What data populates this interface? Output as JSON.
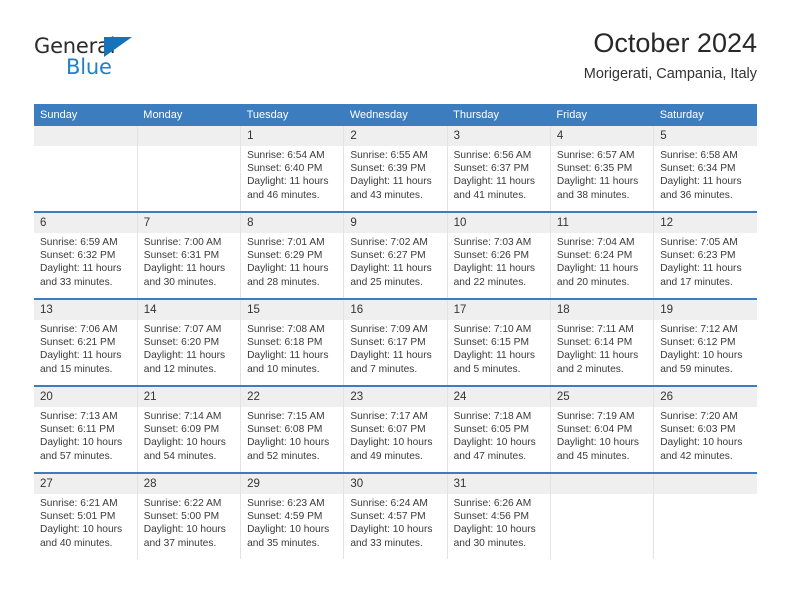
{
  "brand": {
    "name_part1": "General",
    "name_part2": "Blue",
    "accent_color": "#1f81c9",
    "triangle_color": "#1672b9"
  },
  "header": {
    "title": "October 2024",
    "subtitle": "Morigerati, Campania, Italy"
  },
  "calendar": {
    "header_bg": "#3b7dbf",
    "daynum_bg": "#efefef",
    "weekdays": [
      "Sunday",
      "Monday",
      "Tuesday",
      "Wednesday",
      "Thursday",
      "Friday",
      "Saturday"
    ],
    "weeks": [
      [
        {
          "day": "",
          "sunrise": "",
          "sunset": "",
          "daylight_line1": "",
          "daylight_line2": ""
        },
        {
          "day": "",
          "sunrise": "",
          "sunset": "",
          "daylight_line1": "",
          "daylight_line2": ""
        },
        {
          "day": "1",
          "sunrise": "Sunrise: 6:54 AM",
          "sunset": "Sunset: 6:40 PM",
          "daylight_line1": "Daylight: 11 hours",
          "daylight_line2": "and 46 minutes."
        },
        {
          "day": "2",
          "sunrise": "Sunrise: 6:55 AM",
          "sunset": "Sunset: 6:39 PM",
          "daylight_line1": "Daylight: 11 hours",
          "daylight_line2": "and 43 minutes."
        },
        {
          "day": "3",
          "sunrise": "Sunrise: 6:56 AM",
          "sunset": "Sunset: 6:37 PM",
          "daylight_line1": "Daylight: 11 hours",
          "daylight_line2": "and 41 minutes."
        },
        {
          "day": "4",
          "sunrise": "Sunrise: 6:57 AM",
          "sunset": "Sunset: 6:35 PM",
          "daylight_line1": "Daylight: 11 hours",
          "daylight_line2": "and 38 minutes."
        },
        {
          "day": "5",
          "sunrise": "Sunrise: 6:58 AM",
          "sunset": "Sunset: 6:34 PM",
          "daylight_line1": "Daylight: 11 hours",
          "daylight_line2": "and 36 minutes."
        }
      ],
      [
        {
          "day": "6",
          "sunrise": "Sunrise: 6:59 AM",
          "sunset": "Sunset: 6:32 PM",
          "daylight_line1": "Daylight: 11 hours",
          "daylight_line2": "and 33 minutes."
        },
        {
          "day": "7",
          "sunrise": "Sunrise: 7:00 AM",
          "sunset": "Sunset: 6:31 PM",
          "daylight_line1": "Daylight: 11 hours",
          "daylight_line2": "and 30 minutes."
        },
        {
          "day": "8",
          "sunrise": "Sunrise: 7:01 AM",
          "sunset": "Sunset: 6:29 PM",
          "daylight_line1": "Daylight: 11 hours",
          "daylight_line2": "and 28 minutes."
        },
        {
          "day": "9",
          "sunrise": "Sunrise: 7:02 AM",
          "sunset": "Sunset: 6:27 PM",
          "daylight_line1": "Daylight: 11 hours",
          "daylight_line2": "and 25 minutes."
        },
        {
          "day": "10",
          "sunrise": "Sunrise: 7:03 AM",
          "sunset": "Sunset: 6:26 PM",
          "daylight_line1": "Daylight: 11 hours",
          "daylight_line2": "and 22 minutes."
        },
        {
          "day": "11",
          "sunrise": "Sunrise: 7:04 AM",
          "sunset": "Sunset: 6:24 PM",
          "daylight_line1": "Daylight: 11 hours",
          "daylight_line2": "and 20 minutes."
        },
        {
          "day": "12",
          "sunrise": "Sunrise: 7:05 AM",
          "sunset": "Sunset: 6:23 PM",
          "daylight_line1": "Daylight: 11 hours",
          "daylight_line2": "and 17 minutes."
        }
      ],
      [
        {
          "day": "13",
          "sunrise": "Sunrise: 7:06 AM",
          "sunset": "Sunset: 6:21 PM",
          "daylight_line1": "Daylight: 11 hours",
          "daylight_line2": "and 15 minutes."
        },
        {
          "day": "14",
          "sunrise": "Sunrise: 7:07 AM",
          "sunset": "Sunset: 6:20 PM",
          "daylight_line1": "Daylight: 11 hours",
          "daylight_line2": "and 12 minutes."
        },
        {
          "day": "15",
          "sunrise": "Sunrise: 7:08 AM",
          "sunset": "Sunset: 6:18 PM",
          "daylight_line1": "Daylight: 11 hours",
          "daylight_line2": "and 10 minutes."
        },
        {
          "day": "16",
          "sunrise": "Sunrise: 7:09 AM",
          "sunset": "Sunset: 6:17 PM",
          "daylight_line1": "Daylight: 11 hours",
          "daylight_line2": "and 7 minutes."
        },
        {
          "day": "17",
          "sunrise": "Sunrise: 7:10 AM",
          "sunset": "Sunset: 6:15 PM",
          "daylight_line1": "Daylight: 11 hours",
          "daylight_line2": "and 5 minutes."
        },
        {
          "day": "18",
          "sunrise": "Sunrise: 7:11 AM",
          "sunset": "Sunset: 6:14 PM",
          "daylight_line1": "Daylight: 11 hours",
          "daylight_line2": "and 2 minutes."
        },
        {
          "day": "19",
          "sunrise": "Sunrise: 7:12 AM",
          "sunset": "Sunset: 6:12 PM",
          "daylight_line1": "Daylight: 10 hours",
          "daylight_line2": "and 59 minutes."
        }
      ],
      [
        {
          "day": "20",
          "sunrise": "Sunrise: 7:13 AM",
          "sunset": "Sunset: 6:11 PM",
          "daylight_line1": "Daylight: 10 hours",
          "daylight_line2": "and 57 minutes."
        },
        {
          "day": "21",
          "sunrise": "Sunrise: 7:14 AM",
          "sunset": "Sunset: 6:09 PM",
          "daylight_line1": "Daylight: 10 hours",
          "daylight_line2": "and 54 minutes."
        },
        {
          "day": "22",
          "sunrise": "Sunrise: 7:15 AM",
          "sunset": "Sunset: 6:08 PM",
          "daylight_line1": "Daylight: 10 hours",
          "daylight_line2": "and 52 minutes."
        },
        {
          "day": "23",
          "sunrise": "Sunrise: 7:17 AM",
          "sunset": "Sunset: 6:07 PM",
          "daylight_line1": "Daylight: 10 hours",
          "daylight_line2": "and 49 minutes."
        },
        {
          "day": "24",
          "sunrise": "Sunrise: 7:18 AM",
          "sunset": "Sunset: 6:05 PM",
          "daylight_line1": "Daylight: 10 hours",
          "daylight_line2": "and 47 minutes."
        },
        {
          "day": "25",
          "sunrise": "Sunrise: 7:19 AM",
          "sunset": "Sunset: 6:04 PM",
          "daylight_line1": "Daylight: 10 hours",
          "daylight_line2": "and 45 minutes."
        },
        {
          "day": "26",
          "sunrise": "Sunrise: 7:20 AM",
          "sunset": "Sunset: 6:03 PM",
          "daylight_line1": "Daylight: 10 hours",
          "daylight_line2": "and 42 minutes."
        }
      ],
      [
        {
          "day": "27",
          "sunrise": "Sunrise: 6:21 AM",
          "sunset": "Sunset: 5:01 PM",
          "daylight_line1": "Daylight: 10 hours",
          "daylight_line2": "and 40 minutes."
        },
        {
          "day": "28",
          "sunrise": "Sunrise: 6:22 AM",
          "sunset": "Sunset: 5:00 PM",
          "daylight_line1": "Daylight: 10 hours",
          "daylight_line2": "and 37 minutes."
        },
        {
          "day": "29",
          "sunrise": "Sunrise: 6:23 AM",
          "sunset": "Sunset: 4:59 PM",
          "daylight_line1": "Daylight: 10 hours",
          "daylight_line2": "and 35 minutes."
        },
        {
          "day": "30",
          "sunrise": "Sunrise: 6:24 AM",
          "sunset": "Sunset: 4:57 PM",
          "daylight_line1": "Daylight: 10 hours",
          "daylight_line2": "and 33 minutes."
        },
        {
          "day": "31",
          "sunrise": "Sunrise: 6:26 AM",
          "sunset": "Sunset: 4:56 PM",
          "daylight_line1": "Daylight: 10 hours",
          "daylight_line2": "and 30 minutes."
        },
        {
          "day": "",
          "sunrise": "",
          "sunset": "",
          "daylight_line1": "",
          "daylight_line2": ""
        },
        {
          "day": "",
          "sunrise": "",
          "sunset": "",
          "daylight_line1": "",
          "daylight_line2": ""
        }
      ]
    ]
  }
}
